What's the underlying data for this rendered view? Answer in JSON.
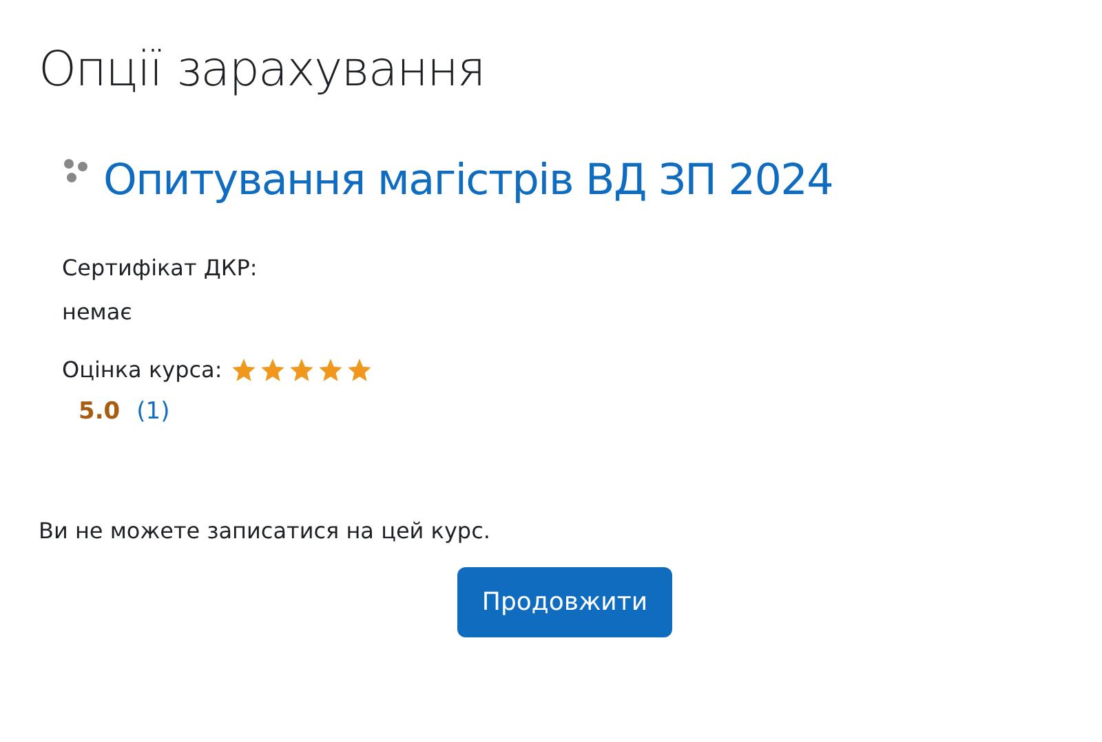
{
  "title": "Опції зарахування",
  "course": {
    "name": "Опитування магістрів ВД ЗП 2024",
    "fields": [
      {
        "label": "Сертифікат ДКР:",
        "value": "немає"
      }
    ],
    "rating": {
      "label": "Оцінка курса:",
      "stars": 5,
      "score": "5.0",
      "count": "(1)"
    }
  },
  "message": "Ви не можете записатися на цей курс.",
  "button": "Продовжити"
}
